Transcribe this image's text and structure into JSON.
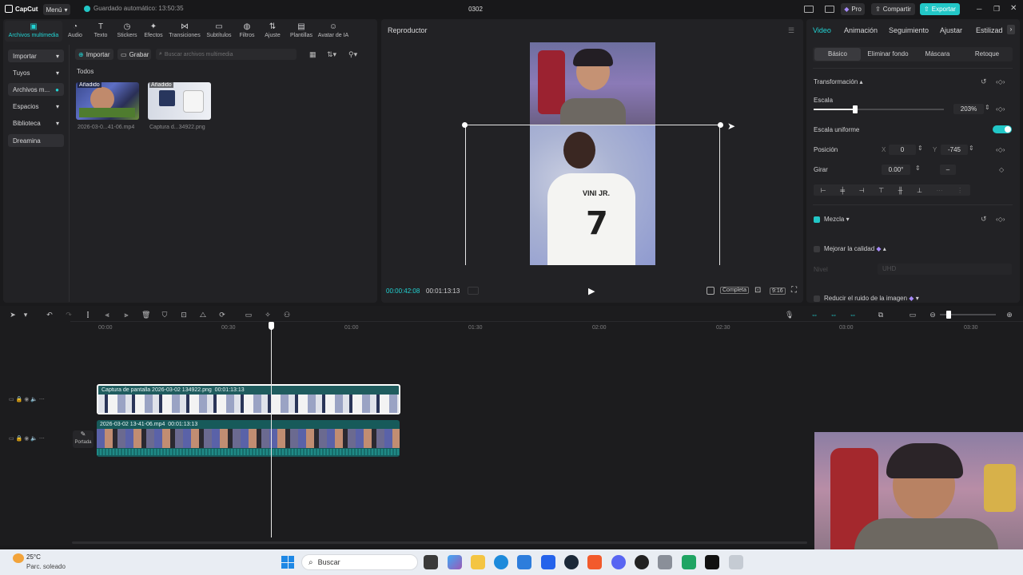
{
  "app": {
    "logo": "CapCut",
    "menu_label": "Menú",
    "autosave": "Guardado automático: 13:50:35",
    "project_title": "0302",
    "pro_label": "Pro",
    "share_label": "Compartir",
    "export_label": "Exportar"
  },
  "toolbar": {
    "tabs": [
      {
        "label": "Archivos multimedia",
        "icon": "media-icon"
      },
      {
        "label": "Audio",
        "icon": "audio-icon"
      },
      {
        "label": "Texto",
        "icon": "text-icon"
      },
      {
        "label": "Stickers",
        "icon": "sticker-icon"
      },
      {
        "label": "Efectos",
        "icon": "effects-icon"
      },
      {
        "label": "Transiciones",
        "icon": "transitions-icon"
      },
      {
        "label": "Subtítulos",
        "icon": "subtitles-icon"
      },
      {
        "label": "Filtros",
        "icon": "filters-icon"
      },
      {
        "label": "Ajuste",
        "icon": "adjust-icon"
      },
      {
        "label": "Plantillas",
        "icon": "templates-icon"
      },
      {
        "label": "Avatar de IA",
        "icon": "ai-avatar-icon"
      }
    ]
  },
  "sidebar": {
    "items": [
      {
        "label": "Importar"
      },
      {
        "label": "Tuyos"
      },
      {
        "label": "Archivos m..."
      },
      {
        "label": "Espacios"
      },
      {
        "label": "Biblioteca"
      },
      {
        "label": "Dreamina"
      }
    ]
  },
  "media": {
    "import_label": "Importar",
    "record_label": "Grabar",
    "search_placeholder": "Buscar archivos multimedia",
    "filter_label": "Todos",
    "items": [
      {
        "badge": "Añadido",
        "caption": "2026-03-0...41-06.mp4"
      },
      {
        "badge": "Añadido",
        "caption": "Captura d...34922.png"
      }
    ]
  },
  "player": {
    "title": "Reproductor",
    "current_time": "00:00:42:08",
    "total_time": "00:01:13:13",
    "view_mode": "Completa",
    "aspect": "9:16"
  },
  "inspector": {
    "tabs": [
      "Video",
      "Animación",
      "Seguimiento",
      "Ajustar",
      "Estilizad"
    ],
    "sub_tabs": [
      "Básico",
      "Eliminar fondo",
      "Máscara",
      "Retoque"
    ],
    "transform_title": "Transformación",
    "scale_label": "Escala",
    "scale_value": "203%",
    "scale_fraction": 0.32,
    "uniform_scale_label": "Escala uniforme",
    "uniform_scale_on": true,
    "position_label": "Posición",
    "pos_x_label": "X",
    "pos_x": "0",
    "pos_y_label": "Y",
    "pos_y": "-745",
    "rotate_label": "Girar",
    "rotate_value": "0.00°",
    "blend_label": "Mezcla",
    "enhance_label": "Mejorar la calidad",
    "level_label": "Nivel",
    "level_value": "UHD",
    "noise_label": "Reducir el ruido de la imagen"
  },
  "timeline": {
    "ruler": [
      "00:00",
      "00:30",
      "01:00",
      "01:30",
      "02:00",
      "02:30",
      "03:00",
      "03:30"
    ],
    "clips": [
      {
        "label": "Captura de pantalla 2026-03-02 134922.png",
        "duration": "00:01:13:13"
      },
      {
        "label": "2026-03-02 13-41-06.mp4",
        "duration": "00:01:13:13"
      }
    ],
    "cover_label": "Portada"
  },
  "taskbar": {
    "weather_temp": "25°C",
    "weather_desc": "Parc. soleado",
    "search_label": "Buscar"
  },
  "colors": {
    "accent": "#22d3d3",
    "panel": "#222225",
    "background": "#1a1a1c"
  }
}
